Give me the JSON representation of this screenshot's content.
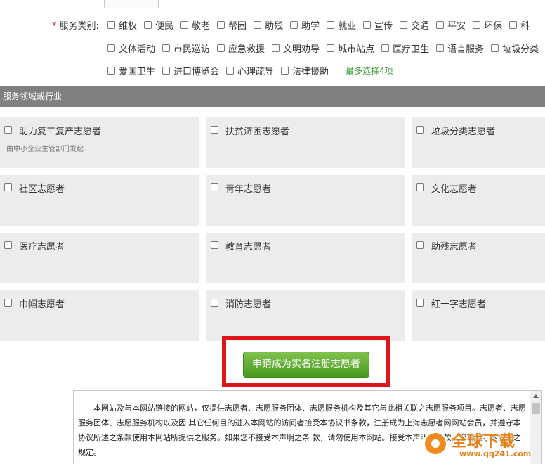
{
  "service_category": {
    "label": "服务类别:",
    "required_mark": "*",
    "rows": [
      [
        "维权",
        "便民",
        "敬老",
        "帮困",
        "助残",
        "助学",
        "就业",
        "宣传",
        "交通",
        "平安",
        "环保",
        "科"
      ],
      [
        "文体活动",
        "市民巡访",
        "应急救援",
        "文明劝导",
        "城市站点",
        "医疗卫生",
        "语言服务",
        "垃圾分类"
      ],
      [
        "爱国卫生",
        "进口博览会",
        "心理疏导",
        "法律援助"
      ]
    ],
    "hint": "最多选择4项"
  },
  "section": {
    "title": "服务领域或行业"
  },
  "volunteer_types": [
    {
      "title": "助力复工复产志愿者",
      "sub": "由中小企业主管部门发起"
    },
    {
      "title": "扶贫济困志愿者",
      "sub": ""
    },
    {
      "title": "垃圾分类志愿者",
      "sub": ""
    },
    {
      "title": "社区志愿者",
      "sub": ""
    },
    {
      "title": "青年志愿者",
      "sub": ""
    },
    {
      "title": "文化志愿者",
      "sub": ""
    },
    {
      "title": "医疗志愿者",
      "sub": ""
    },
    {
      "title": "教育志愿者",
      "sub": ""
    },
    {
      "title": "助残志愿者",
      "sub": ""
    },
    {
      "title": "巾帼志愿者",
      "sub": ""
    },
    {
      "title": "消防志愿者",
      "sub": ""
    },
    {
      "title": "红十字志愿者",
      "sub": ""
    }
  ],
  "apply_button": "申请成为实名注册志愿者",
  "terms_text": "本网站及与本网站链接的网站，仅提供志愿者、志愿服务团体、志愿服务机构及其它与此相关联之志愿服务项目。志愿者、志愿服务团体、志愿服务机构以及因 其它任何目的进入本网站的访问者接受本协议书条款，注册成为上海志愿者网网站会员，并遵守本协议所述之条款使用本网站所提供之服务。如果您不接受本声明之条 款，请勿使用本网站。接受本声明之条款，您将遵守本协议之规定。",
  "watermark": {
    "title": "全球下载",
    "url": "www.qq241.com"
  },
  "colors": {
    "section_bar": "#808080",
    "card_bg": "#ececec",
    "button_green": "#4a9a22",
    "highlight_red": "#e0151c",
    "hint_green": "#3b9b35"
  }
}
